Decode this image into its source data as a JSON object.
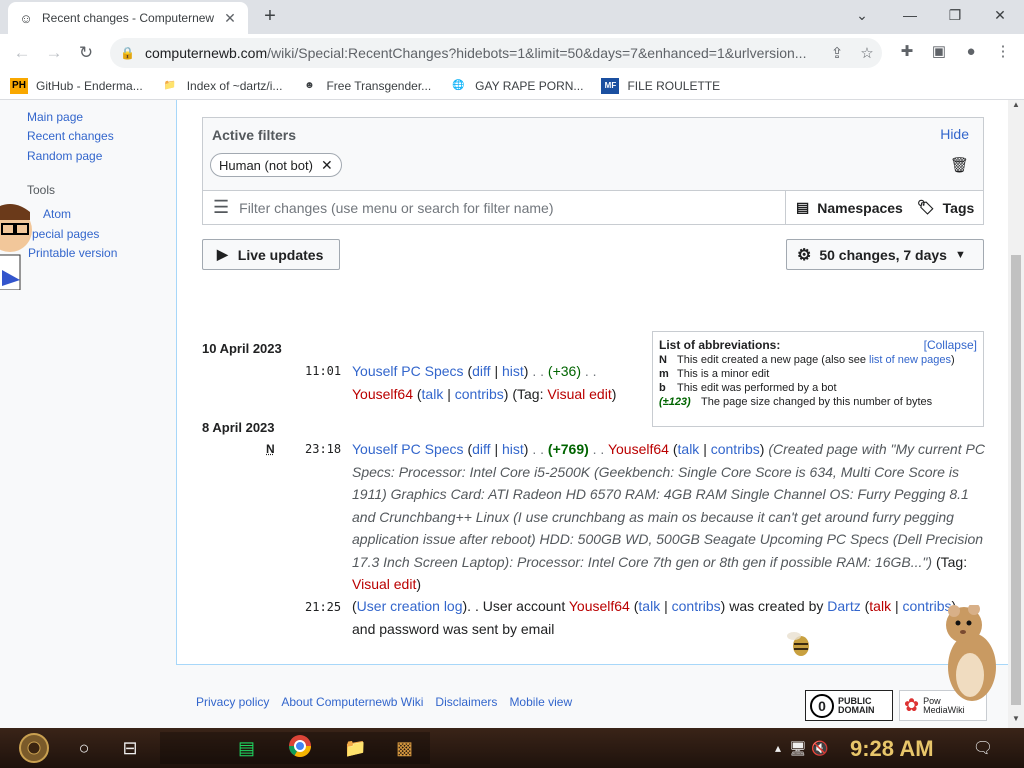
{
  "browser": {
    "tab_title": "Recent changes - Computernew",
    "tab_close": "✕",
    "new_tab": "+",
    "window_min": "⌄",
    "url_main": "computernewb.com",
    "url_rest": "/wiki/Special:RecentChanges?hidebots=1&limit=50&days=7&enhanced=1&urlversion..."
  },
  "bookmarks": [
    {
      "icon": "PH",
      "label": "GitHub - Enderma..."
    },
    {
      "icon": "📁",
      "label": "Index of ~dartz/i..."
    },
    {
      "icon": "☻",
      "label": "Free Transgender..."
    },
    {
      "icon": "🌐",
      "label": "GAY RAPE PORN..."
    },
    {
      "icon": "MF",
      "label": "FILE ROULETTE"
    }
  ],
  "sidebar": {
    "main_page": "Main page",
    "recent_changes": "Recent changes",
    "random_page": "Random page",
    "tools_heading": "Tools",
    "atom": "Atom",
    "special_pages": "pecial pages",
    "printable_version": "Printable version"
  },
  "filters": {
    "heading": "Active filters",
    "hide": "Hide",
    "chip": "Human (not bot)",
    "search_placeholder": "Filter changes (use menu or search for filter name)",
    "namespaces": "Namespaces",
    "tags": "Tags",
    "live_updates": "Live updates",
    "changes_summary": "50 changes, 7 days"
  },
  "legend": {
    "title": "List of abbreviations:",
    "collapse": "[Collapse]",
    "n_key": "N",
    "n_text": "This edit created a new page (also see ",
    "n_link": "list of new pages",
    "n_end": ")",
    "m_key": "m",
    "m_text": "This is a minor edit",
    "b_key": "b",
    "b_text": "This edit was performed by a bot",
    "size_key": "(±123)",
    "size_text": "The page size changed by this number of bytes"
  },
  "changes": [
    {
      "date": "10 April 2023",
      "entries": [
        {
          "time": "11:01",
          "page": "Youself PC Specs",
          "diff": "diff",
          "hist": "hist",
          "size": "(+36)",
          "user": "Youself64",
          "talk": "talk",
          "contribs": "contribs",
          "tag_prefix": "(Tag: ",
          "tag": "Visual edit",
          "tag_suffix": ")"
        }
      ]
    },
    {
      "date": "8 April 2023",
      "entries": [
        {
          "flag": "N",
          "time": "23:18",
          "page": "Youself PC Specs",
          "diff": "diff",
          "hist": "hist",
          "size": "(+769)",
          "user": "Youself64",
          "talk": "talk",
          "contribs": "contribs",
          "summary": "(Created page with \"My current PC Specs: Processor: Intel Core i5-2500K (Geekbench: Single Core Score is 634, Multi Core Score is 1911) Graphics Card: ATI Radeon HD 6570 RAM: 4GB RAM Single Channel OS: Furry Pegging 8.1 and Crunchbang++ Linux (I use crunchbang as main os because it can't get around furry pegging application issue after reboot) HDD: 500GB WD, 500GB Seagate Upcoming PC Specs (Dell Precision 17.3 Inch Screen Laptop): Processor: Intel Core 7th gen or 8th gen if possible RAM: 16GB...\")",
          "tag_prefix": "(Tag: ",
          "tag": "Visual edit",
          "tag_suffix": ")"
        },
        {
          "time": "21:25",
          "log": "User creation log",
          "text1": ". . User account ",
          "user": "Youself64",
          "talk": "talk",
          "contribs": "contribs",
          "text2": " was created by ",
          "creator": "Dartz",
          "talk2": "talk",
          "contribs2": "contribs",
          "text3": "and password was sent by email"
        }
      ]
    }
  ],
  "footer": {
    "privacy": "Privacy policy",
    "about": "About Computernewb Wiki",
    "disclaimers": "Disclaimers",
    "mobile": "Mobile view",
    "pd_line1": "PUBLIC",
    "pd_line2": "DOMAIN",
    "mw_line1": "Pow",
    "mw_line2": "MediaWiki"
  },
  "taskbar": {
    "clock": "9:28 AM"
  },
  "colors": {
    "link": "#3366cc",
    "user_link": "#ba0000",
    "size_positive": "#006400"
  }
}
